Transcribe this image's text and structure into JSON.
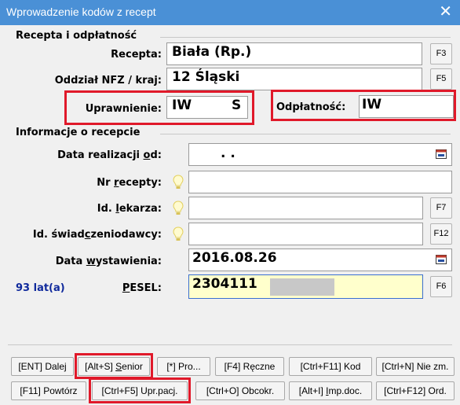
{
  "window": {
    "title": "Wprowadzenie kodów z recept",
    "close_icon": "close-icon"
  },
  "section1": {
    "title": "Recepta i odpłatność",
    "recepta": {
      "label": "Recepta:",
      "value": "Biała (Rp.)",
      "button": "F3"
    },
    "oddzial": {
      "label": "Oddział NFZ / kraj:",
      "value": "12 Śląski",
      "button": "F5"
    },
    "uprawnienie": {
      "label": "Uprawnienie:",
      "code": "IW",
      "flag": "S"
    },
    "odplatnosc": {
      "label": "Odpłatność:",
      "value": "IW"
    }
  },
  "section2": {
    "title": "Informacje o recepcie",
    "data_realizacji": {
      "label_pre": "Data realizacji ",
      "label_u": "o",
      "label_post": "d:",
      "value": ". ."
    },
    "nr_recepty": {
      "label_pre": "Nr ",
      "label_u": "r",
      "label_post": "ecepty:",
      "value": ""
    },
    "id_lekarza": {
      "label_pre": "Id. ",
      "label_u": "l",
      "label_post": "ekarza:",
      "value": "",
      "button": "F7"
    },
    "id_swiadczeniodawcy": {
      "label_pre": "Id. świad",
      "label_u": "c",
      "label_post": "zeniodawcy:",
      "value": "",
      "button": "F12"
    },
    "data_wystawienia": {
      "label_pre": "Data ",
      "label_u": "w",
      "label_post": "ystawienia:",
      "value": "2016.08.26"
    },
    "age": "93 lat(a)",
    "pesel": {
      "label_pre": "",
      "label_u": "P",
      "label_post": "ESEL:",
      "value": "2304111",
      "button": "F6"
    }
  },
  "toolbar": {
    "row1": [
      {
        "pre": "[ENT] Dalej",
        "u": "",
        "post": ""
      },
      {
        "pre": "[Alt+S] ",
        "u": "S",
        "post": "enior"
      },
      {
        "pre": "[*] Pro...",
        "u": "",
        "post": ""
      },
      {
        "pre": "[F4] Ręczne",
        "u": "",
        "post": ""
      },
      {
        "pre": "[Ctrl+F11] Kod",
        "u": "",
        "post": ""
      },
      {
        "pre": "[Ctrl+N] Nie zm.",
        "u": "",
        "post": ""
      }
    ],
    "row2": [
      {
        "pre": "[F11] Powtórz",
        "u": "",
        "post": ""
      },
      {
        "pre": "[Ctrl+F5] Upr.pacj.",
        "u": "",
        "post": ""
      },
      {
        "pre": "[Ctrl+O] Obcokr.",
        "u": "",
        "post": ""
      },
      {
        "pre": "[Alt+I] ",
        "u": "I",
        "post": "mp.doc."
      },
      {
        "pre": "[Ctrl+F12] Ord.",
        "u": "",
        "post": ""
      }
    ]
  },
  "colors": {
    "titlebar": "#4a90d6",
    "highlight_border": "#e0192a",
    "pesel_field_bg": "#ffffcc",
    "age_text": "#102a9c"
  }
}
